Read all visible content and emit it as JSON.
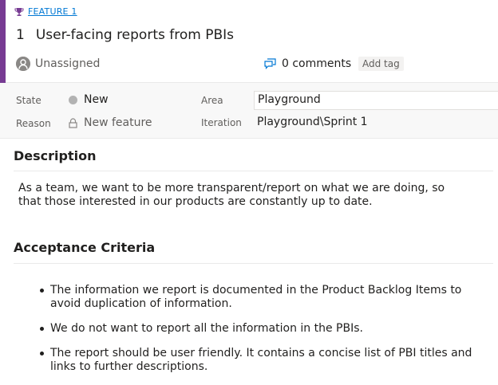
{
  "work_item": {
    "type_label": "FEATURE 1",
    "id": "1",
    "title": "User-facing reports from PBIs",
    "assigned_to": "Unassigned",
    "comments_label": "0 comments",
    "add_tag_label": "Add tag",
    "accent_color": "#773b93"
  },
  "fields": {
    "state_label": "State",
    "state_value": "New",
    "reason_label": "Reason",
    "reason_value": "New feature",
    "area_label": "Area",
    "area_value": "Playground",
    "iteration_label": "Iteration",
    "iteration_value": "Playground\\Sprint 1"
  },
  "description": {
    "heading": "Description",
    "text": "As a team, we want to be more transparent/report on what we are doing, so that those interested in our products are constantly up to date."
  },
  "acceptance": {
    "heading": "Acceptance Criteria",
    "items": [
      "The information we report is documented in the Product Backlog Items to avoid duplication of information.",
      "We do not want to report all the information in the PBIs.",
      "The report should be user friendly. It contains a concise list of PBI titles and links to further descriptions."
    ]
  }
}
